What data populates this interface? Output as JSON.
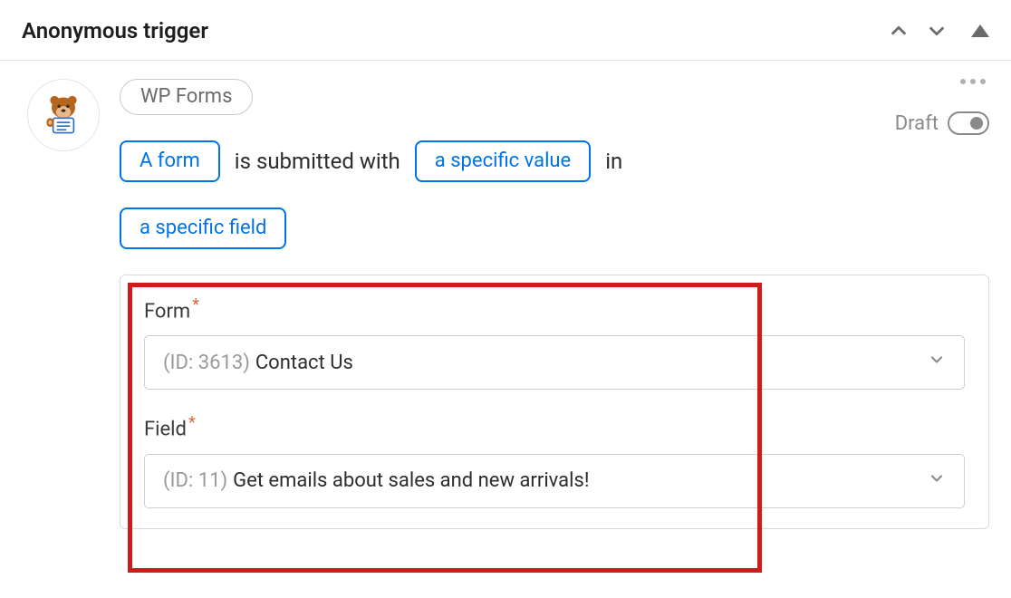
{
  "header": {
    "title": "Anonymous trigger"
  },
  "trigger": {
    "integration_tag": "WP Forms",
    "token_form": "A form",
    "text_submitted_with": "is submitted with",
    "token_value": "a specific value",
    "text_in": "in",
    "token_field": "a specific field",
    "status_label": "Draft"
  },
  "fields": {
    "form": {
      "label": "Form",
      "id_prefix": "(ID: 3613)",
      "value": "Contact Us"
    },
    "field": {
      "label": "Field",
      "id_prefix": "(ID: 11)",
      "value": "Get emails about sales and new arrivals!"
    }
  }
}
